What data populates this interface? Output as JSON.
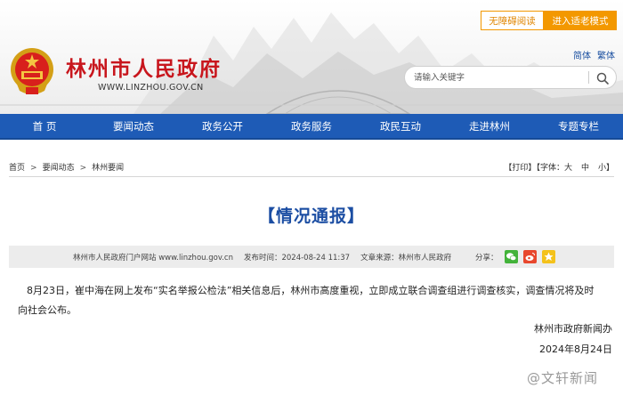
{
  "header": {
    "site_title": "林州市人民政府",
    "site_url": "WWW.LINZHOU.GOV.CN",
    "accessibility_button": "无障碍阅读",
    "elder_mode_button": "进入适老模式",
    "lang_simplified": "简体",
    "lang_traditional": "繁体",
    "search_placeholder": "请输入关键字",
    "emblem": "national-emblem",
    "search_icon": "search-icon"
  },
  "nav": [
    "首 页",
    "要闻动态",
    "政务公开",
    "政务服务",
    "政民互动",
    "走进林州",
    "专题专栏"
  ],
  "breadcrumb": {
    "items": [
      "首页",
      "要闻动态",
      "林州要闻"
    ],
    "separator": ">"
  },
  "tools": {
    "print": "【打印】",
    "font_label": "【字体：",
    "large": "大",
    "medium": "中",
    "small": "小】"
  },
  "article": {
    "title": "【情况通报】",
    "meta_site": "林州市人民政府门户网站 www.linzhou.gov.cn",
    "meta_time": "发布时间：2024-08-24 11:37",
    "meta_source": "文章来源：林州市人民政府",
    "share_label": "分享：",
    "share": [
      "wechat-icon",
      "weibo-icon",
      "qzone-icon"
    ],
    "body_line1": "8月23日，崔中海在网上发布“实名举报公检法”相关信息后，林州市高度重视，立即成立联合调查组进行调查核实，调查情况将及时",
    "body_line2": "向社会公布。",
    "sign_org": "林州市政府新闻办",
    "sign_date": "2024年8月24日"
  },
  "watermark": "@文轩新闻",
  "colors": {
    "brand_red": "#c8161d",
    "nav_blue": "#1e5bb6",
    "title_blue": "#1c4ea3",
    "accent_orange": "#f39800"
  }
}
